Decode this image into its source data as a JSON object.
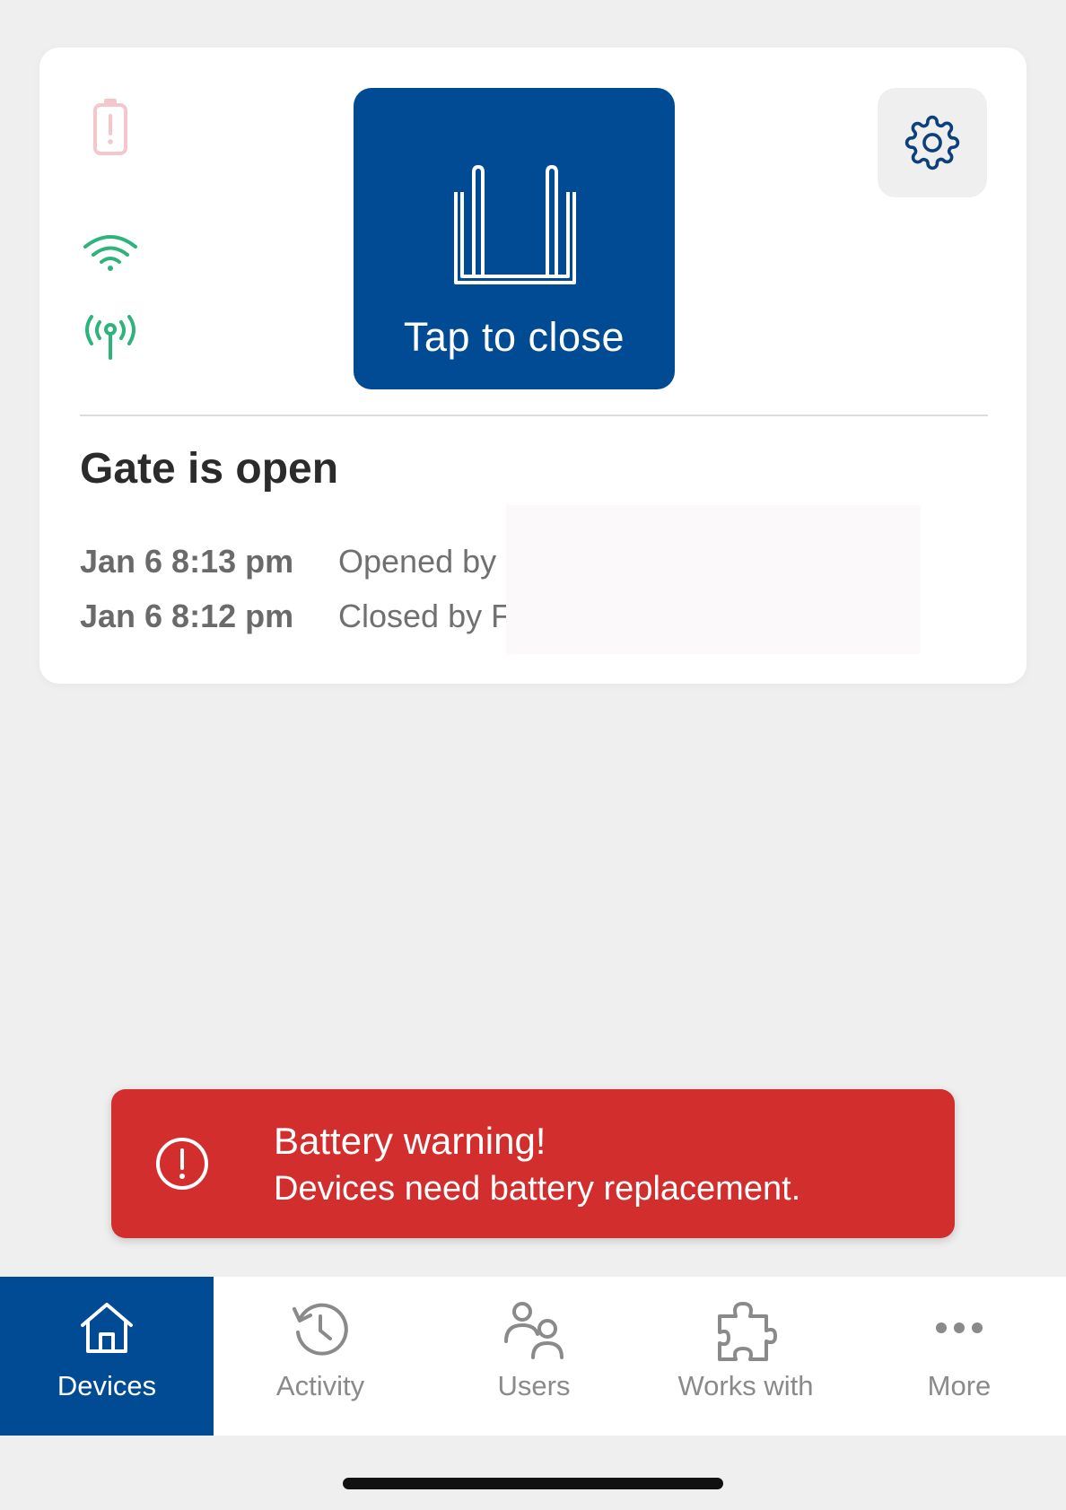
{
  "device_card": {
    "status_icons": {
      "battery": "battery-warning-icon",
      "wifi": "wifi-icon",
      "signal": "antenna-signal-icon"
    },
    "action_button": {
      "label": "Tap to close",
      "icon": "gate-icon"
    },
    "settings_icon": "gear-icon",
    "gate_status": "Gate is open",
    "activity": [
      {
        "time": "Jan 6 8:13 pm",
        "description": "Opened by"
      },
      {
        "time": "Jan 6 8:12 pm",
        "description": "Closed by F"
      }
    ]
  },
  "battery_toast": {
    "icon": "exclamation-circle-icon",
    "title": "Battery warning!",
    "message": "Devices need battery replacement."
  },
  "tab_bar": {
    "tabs": [
      {
        "label": "Devices",
        "icon": "home-icon",
        "active": true
      },
      {
        "label": "Activity",
        "icon": "history-icon",
        "active": false
      },
      {
        "label": "Users",
        "icon": "users-icon",
        "active": false
      },
      {
        "label": "Works with",
        "icon": "puzzle-icon",
        "active": false
      },
      {
        "label": "More",
        "icon": "more-dots-icon",
        "active": false
      }
    ]
  },
  "colors": {
    "primary": "#004b93",
    "warning": "#d32e2e",
    "connectivity_ok": "#2db37c",
    "battery_warning_faded": "#f5c7cc",
    "background": "#efefef"
  }
}
